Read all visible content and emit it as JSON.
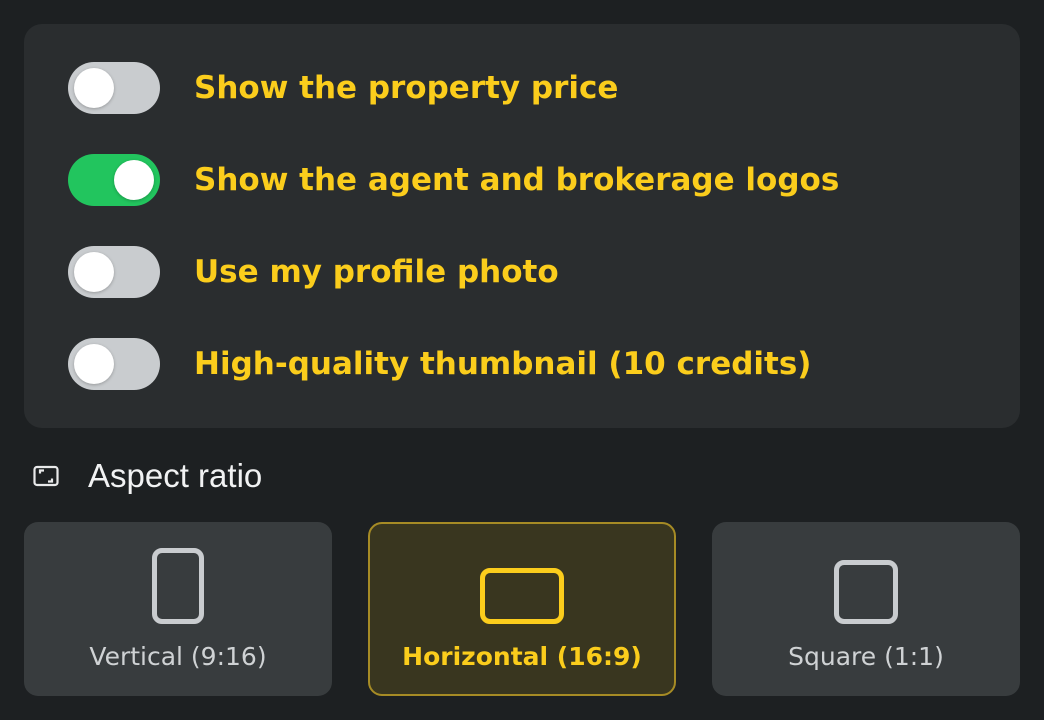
{
  "options": [
    {
      "label": "Show the property price",
      "on": false
    },
    {
      "label": "Show the agent and brokerage logos",
      "on": true
    },
    {
      "label": "Use my profile photo",
      "on": false
    },
    {
      "label": "High-quality thumbnail (10 credits)",
      "on": false
    }
  ],
  "aspect_ratio": {
    "title": "Aspect ratio",
    "icon": "aspect-ratio-icon",
    "choices": [
      {
        "label": "Vertical (9:16)",
        "icon": "portrait-rect-icon",
        "selected": false
      },
      {
        "label": "Horizontal (16:9)",
        "icon": "landscape-rect-icon",
        "selected": true
      },
      {
        "label": "Square (1:1)",
        "icon": "square-icon",
        "selected": false
      }
    ]
  },
  "colors": {
    "accent": "#fbcd1c",
    "toggle_on": "#22c55e",
    "toggle_off": "#c9cccf",
    "panel": "#2a2d2f",
    "background": "#1d2022"
  }
}
